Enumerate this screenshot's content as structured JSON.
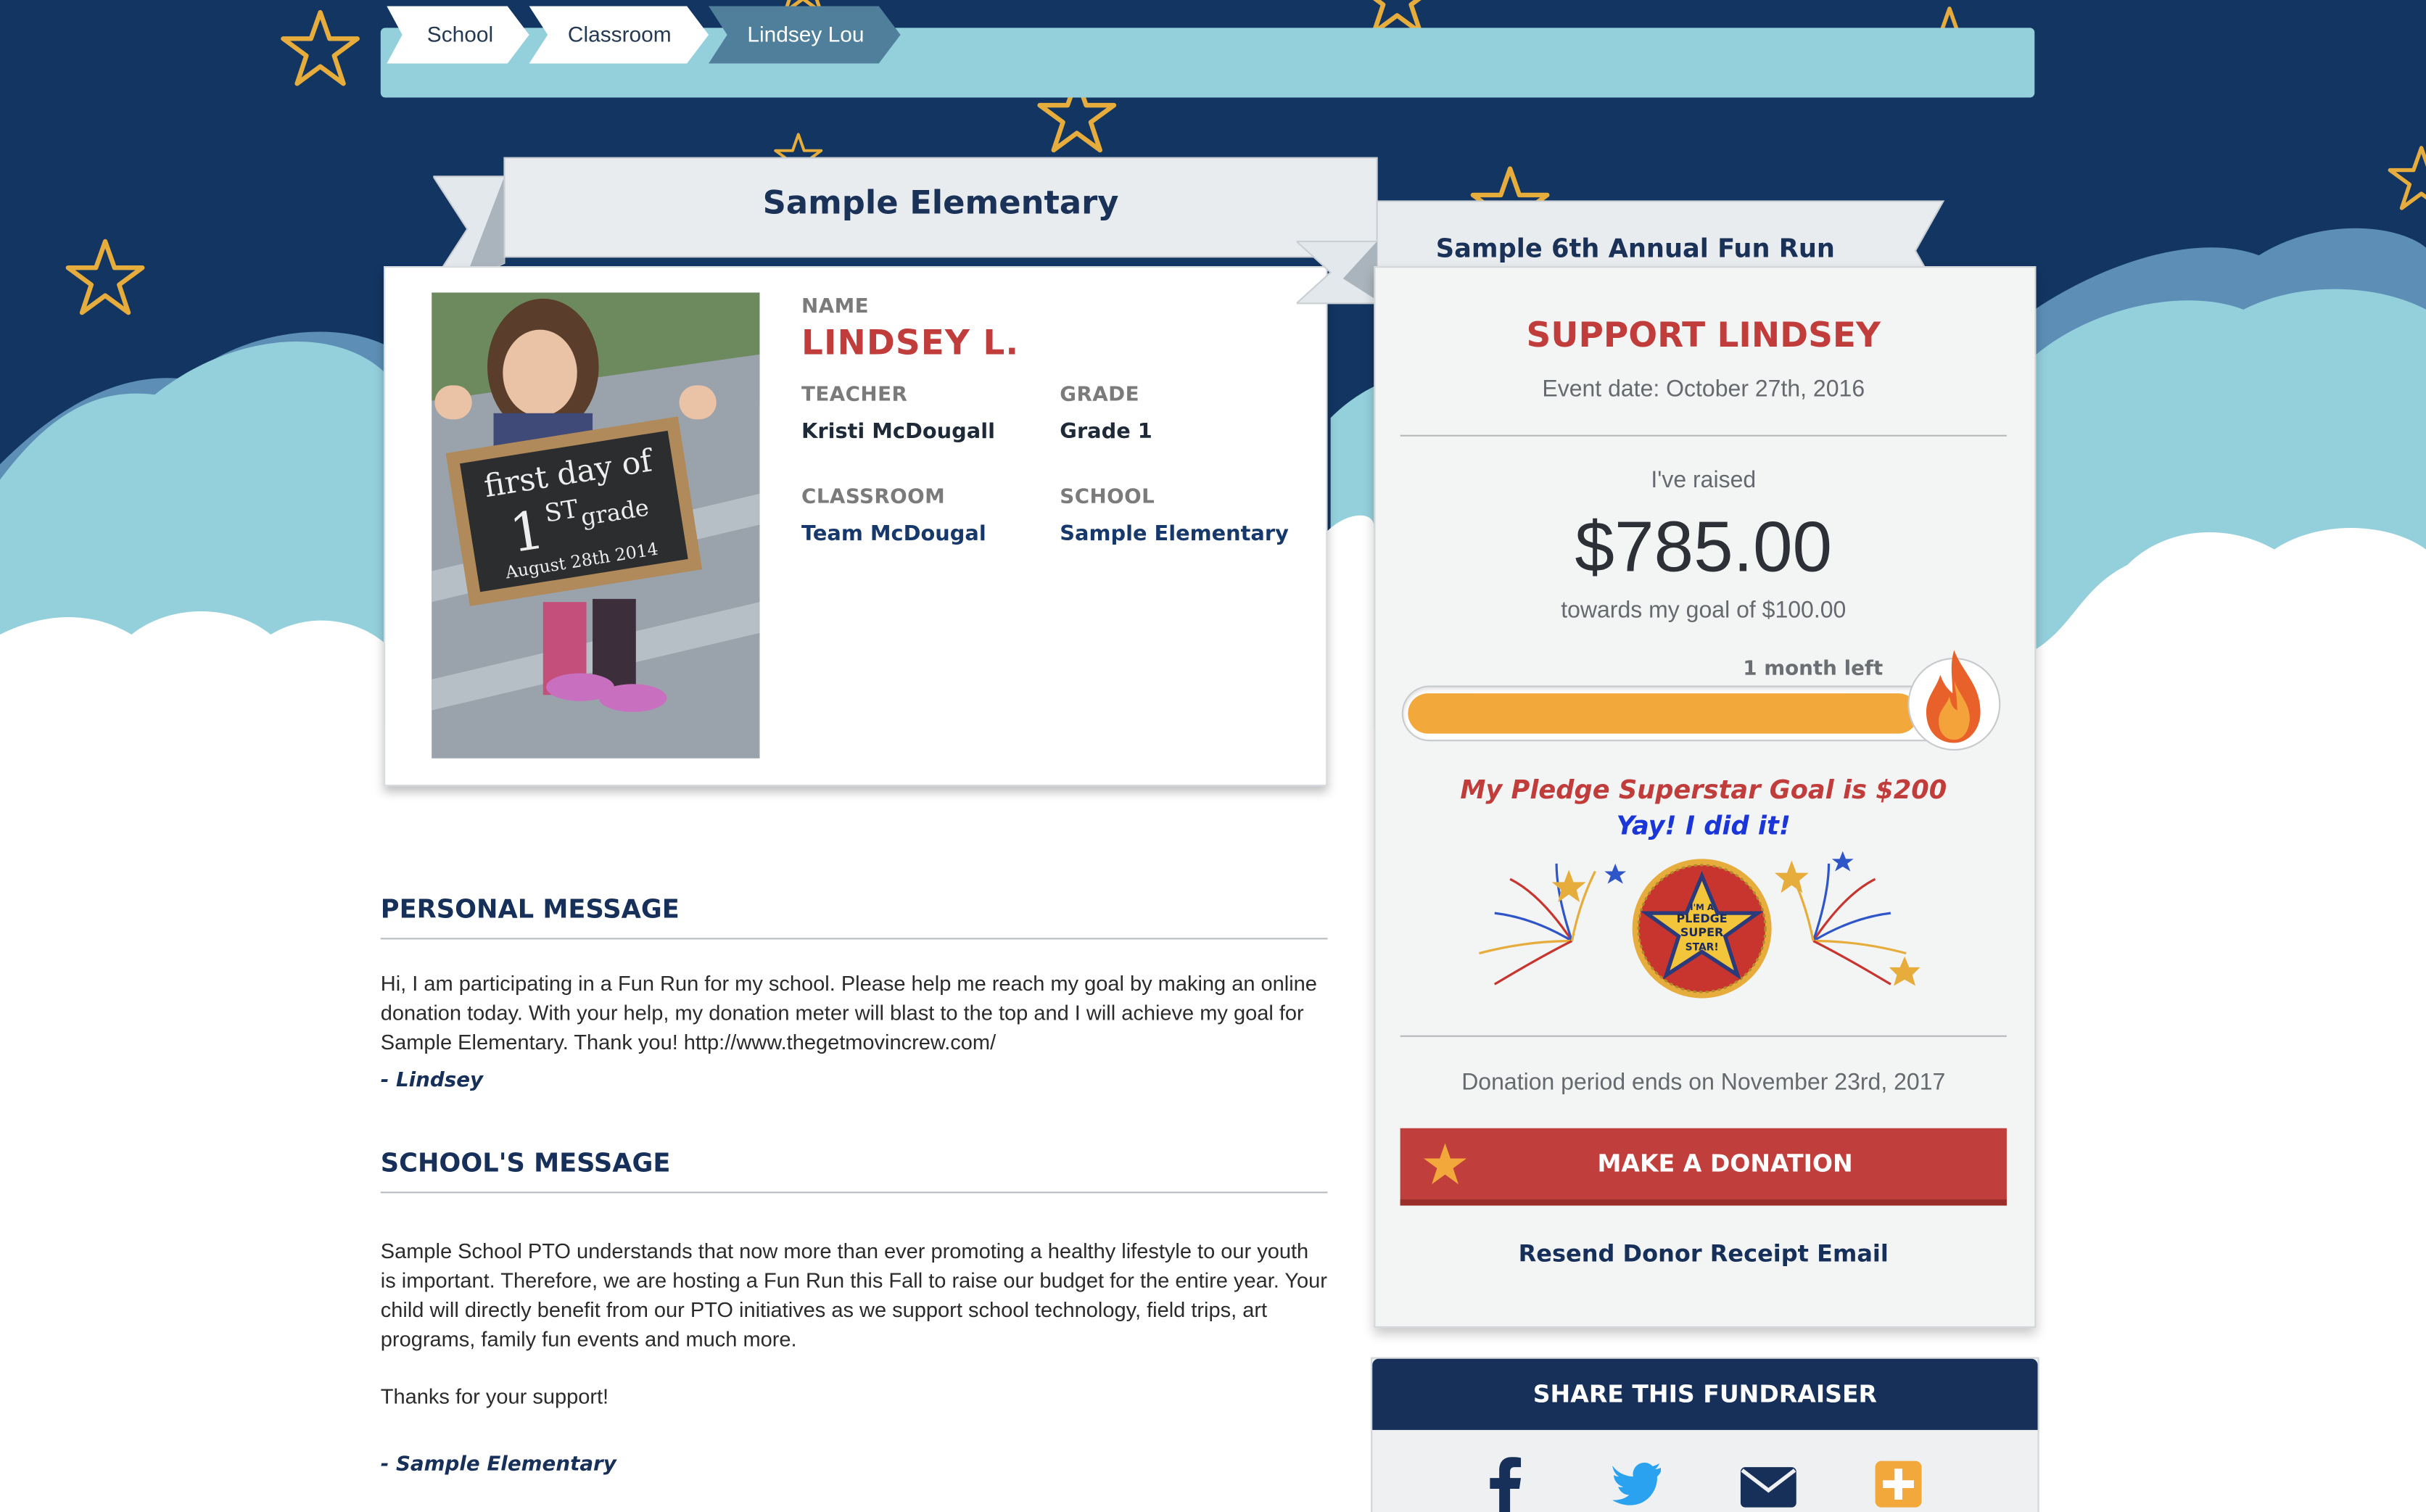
{
  "breadcrumb": {
    "items": [
      {
        "label": "School"
      },
      {
        "label": "Classroom"
      },
      {
        "label": "Lindsey Lou"
      }
    ]
  },
  "school_ribbon": {
    "title": "Sample Elementary"
  },
  "event_ribbon": {
    "title": "Sample 6th Annual Fun Run"
  },
  "student": {
    "name_label": "NAME",
    "name": "LINDSEY L.",
    "teacher_label": "TEACHER",
    "teacher": "Kristi McDougall",
    "grade_label": "GRADE",
    "grade": "Grade 1",
    "classroom_label": "CLASSROOM",
    "classroom": "Team McDougal",
    "school_label": "SCHOOL",
    "school": "Sample Elementary",
    "photo_sign": {
      "line1": "first day of",
      "line2": "1",
      "line3": "ST",
      "line4": "grade",
      "line5": "August 28th 2014"
    }
  },
  "personal_message": {
    "heading": "PERSONAL MESSAGE",
    "body": "Hi, I am participating in a Fun Run for my school. Please help me reach my goal by making an online donation today. With your help, my donation meter will blast to the top and I will achieve my goal for Sample Elementary. Thank you! http://www.thegetmovincrew.com/",
    "signature": "- Lindsey"
  },
  "school_message": {
    "heading": "SCHOOL'S MESSAGE",
    "body": "Sample School PTO understands that now more than ever promoting a healthy lifestyle to our youth is important. Therefore, we are hosting a Fun Run this Fall to raise our budget for the entire year. Your child will directly benefit from our PTO initiatives as we support school technology, field trips, art programs, family fun events and much more.",
    "thanks": "Thanks for your support!",
    "signature": "- Sample Elementary"
  },
  "support": {
    "heading": "SUPPORT LINDSEY",
    "event_date": "Event date: October 27th, 2016",
    "raised_label": "I've raised",
    "raised_amount": "$785.00",
    "goal_text": "towards my goal of $100.00",
    "time_left": "1 month left",
    "progress_fraction": 1.0,
    "superstar_goal": "My Pledge Superstar Goal is $200",
    "superstar_done": "Yay! I did it!",
    "badge_text": [
      "I'M A",
      "PLEDGE",
      "SUPER",
      "STAR!"
    ],
    "period_end": "Donation period ends on November 23rd, 2017",
    "donate_button": "MAKE A DONATION",
    "resend_link": "Resend Donor Receipt Email"
  },
  "share": {
    "heading": "SHARE THIS FUNDRAISER",
    "icons": [
      "facebook-icon",
      "twitter-icon",
      "email-icon",
      "plus-icon"
    ]
  },
  "colors": {
    "night_sky": "#133562",
    "cloud_blue": "#94d0dc",
    "accent_red": "#c03d3b",
    "navy": "#16305a",
    "meter_orange": "#f3a83b",
    "star_gold": "#e7ad3c"
  }
}
